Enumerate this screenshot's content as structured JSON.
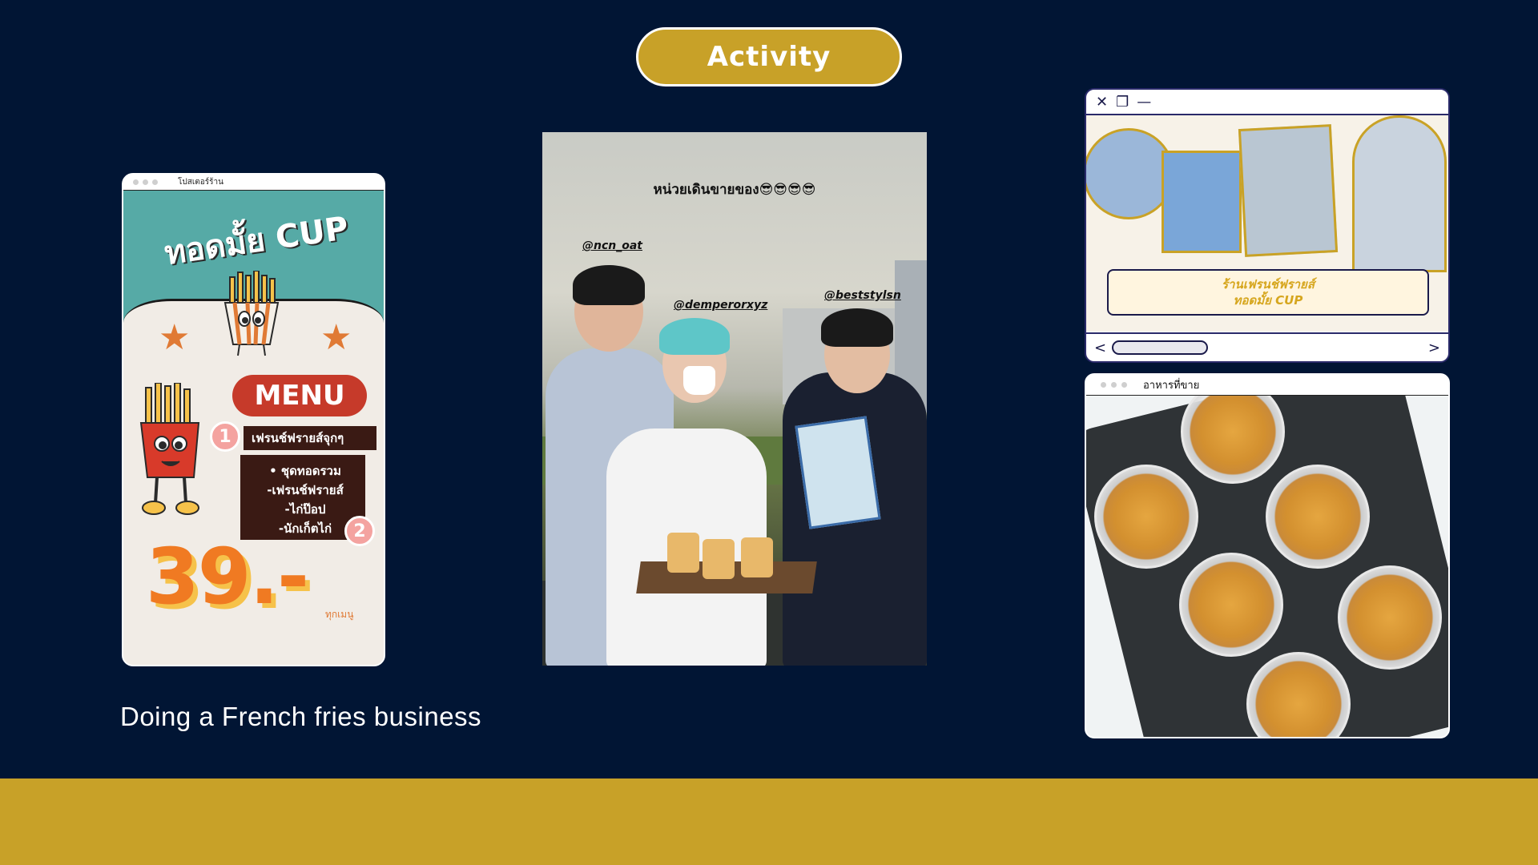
{
  "header": {
    "activity_label": "Activity"
  },
  "caption": "Doing a French fries business",
  "poster": {
    "window_title": "โปสเตอร์ร้าน",
    "brand": "ทอดมั้ย CUP",
    "menu_label": "MENU",
    "item1": "เฟรนช์ฟรายส์จุกๆ",
    "item1_badge": "1",
    "combo_lines": [
      "• ชุดทอดรวม",
      "-เฟรนช์ฟรายส์",
      "-ไก่ป๊อป",
      "-นักเก็ตไก่"
    ],
    "item2_badge": "2",
    "price": "39.-",
    "every_menu": "ทุกเมนู"
  },
  "photo": {
    "story_text": "หน่วยเดินขายของ😎😎😎😎",
    "handles": [
      "@ncn_oat",
      "@demperorxyz",
      "@beststylsn"
    ]
  },
  "collage_window": {
    "controls": [
      "✕",
      "❐",
      "—"
    ],
    "shop_line1": "ร้านเฟรนช์ฟรายส์",
    "shop_line2": "ทอดมั้ย CUP",
    "prev": "<",
    "next": ">"
  },
  "food_window": {
    "title": "อาหารที่ขาย"
  },
  "colors": {
    "background": "#011534",
    "accent_gold": "#c8a128"
  }
}
